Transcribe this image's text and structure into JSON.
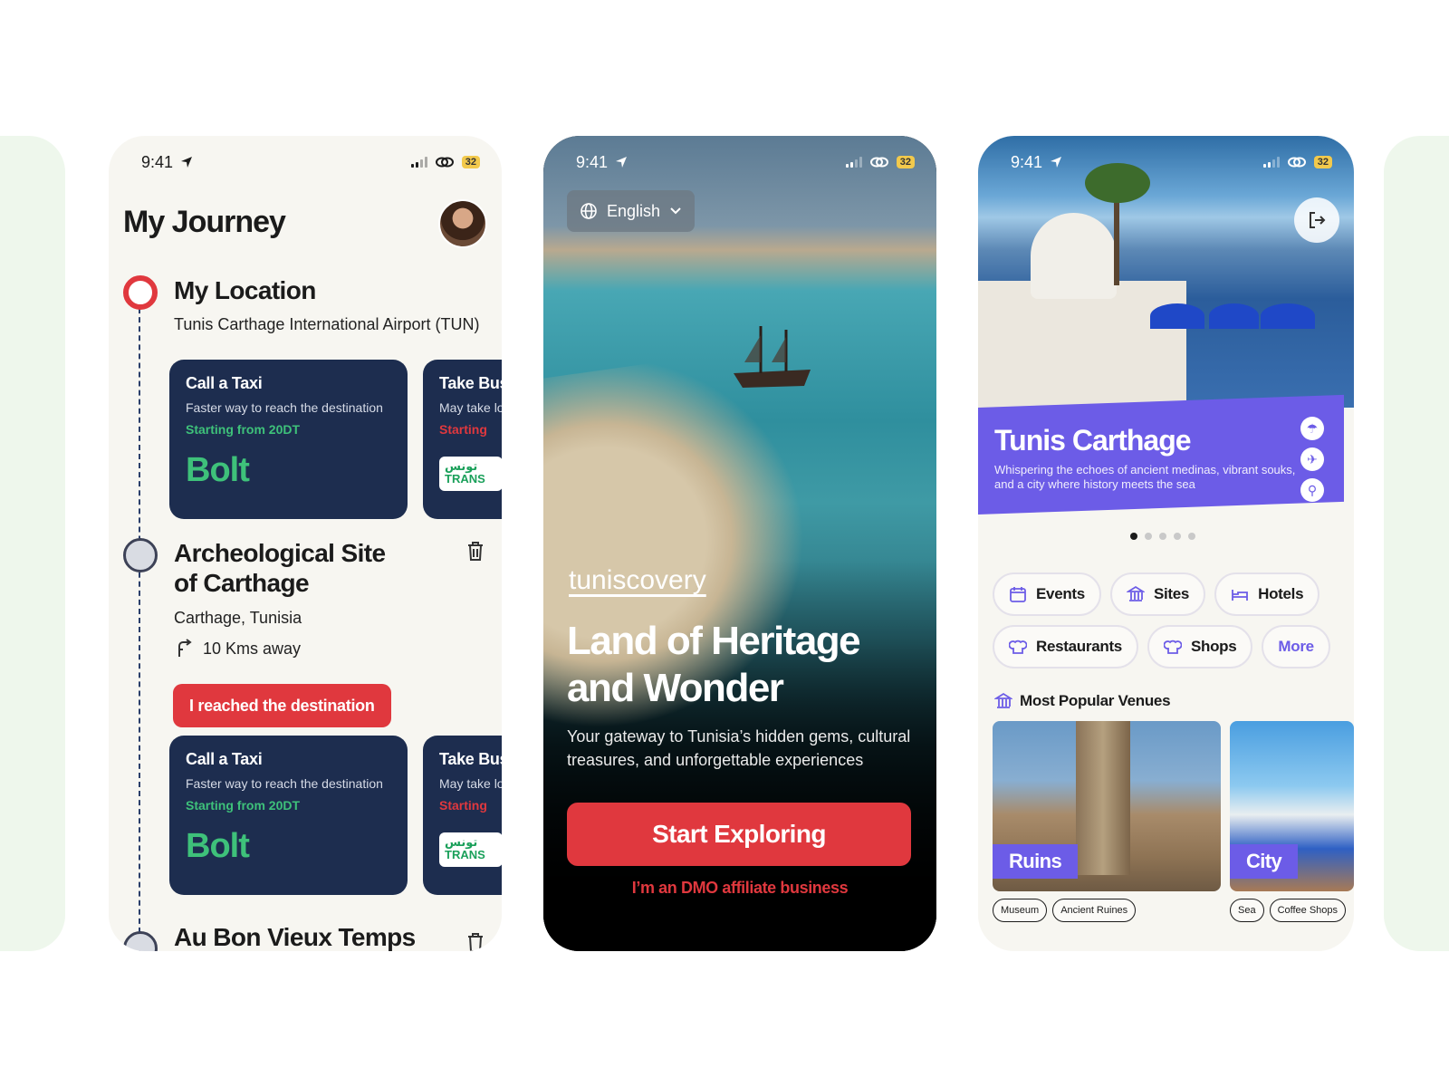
{
  "status_bar": {
    "time": "9:41",
    "battery": "32"
  },
  "journey": {
    "title": "My Journey",
    "stops": [
      {
        "title": "My Location",
        "subtitle": "Tunis Carthage International Airport (TUN)"
      },
      {
        "title_line1": "Archeological Site",
        "title_line2": "of Carthage",
        "subtitle": "Carthage, Tunisia",
        "distance": "10 Kms away",
        "action": "I reached the destination"
      },
      {
        "title": "Au Bon Vieux Temps"
      }
    ],
    "cards": [
      {
        "title": "Call a Taxi",
        "subtitle": "Faster way to reach the destination",
        "price": "Starting from 20DT",
        "logo": "Bolt"
      },
      {
        "title": "Take Bus",
        "subtitle": "May take longer",
        "price": "Starting",
        "logo": "تونس TRANS"
      }
    ]
  },
  "welcome": {
    "language": "English",
    "brand": "tuniscovery",
    "headline": "Land of Heritage and Wonder",
    "tagline": "Your gateway to Tunisia’s hidden gems, cultural treasures, and unforgettable experiences",
    "cta": "Start Exploring",
    "affiliate": "I’m an DMO affiliate business"
  },
  "city": {
    "name": "Tunis Carthage",
    "description": "Whispering the echoes of ancient medinas, vibrant souks, and a city where history meets the sea",
    "carousel_index": 1,
    "carousel_count": 5,
    "categories": [
      "Events",
      "Sites",
      "Hotels",
      "Restaurants",
      "Shops",
      "More"
    ],
    "section_title": "Most Popular Venues",
    "venues": [
      {
        "label": "Ruins",
        "tags": [
          "Museum",
          "Ancient Ruines"
        ]
      },
      {
        "label": "City",
        "tags": [
          "Sea",
          "Coffee Shops"
        ]
      }
    ]
  },
  "colors": {
    "accent_red": "#e0383e",
    "navy": "#1d2d4f",
    "green": "#3ec17a",
    "purple": "#6c5ce7"
  }
}
